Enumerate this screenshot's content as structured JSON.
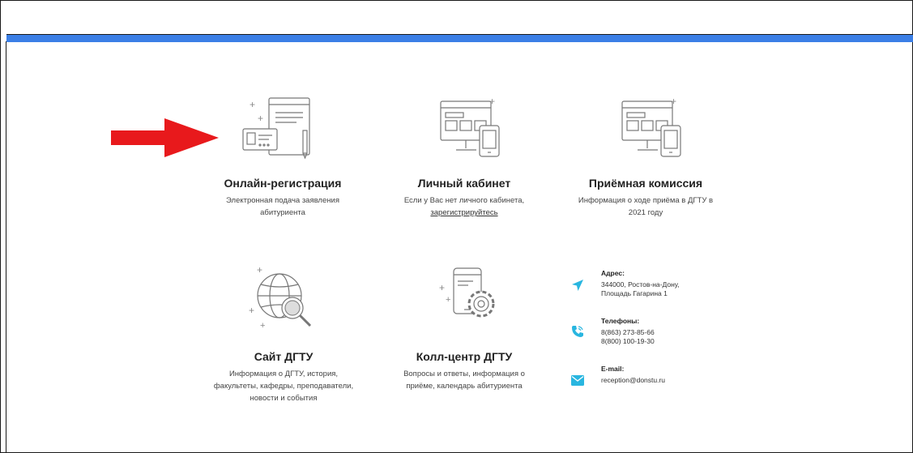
{
  "cards": [
    {
      "title": "Онлайн-регистрация",
      "desc1": "Электронная подача заявления",
      "desc2": "абитуриента"
    },
    {
      "title": "Личный кабинет",
      "desc1": "Если у Вас нет личного кабинета,",
      "link": "зарегистрируйтесь"
    },
    {
      "title": "Приёмная комиссия",
      "desc1": "Информация о ходе приёма в ДГТУ в",
      "desc2": "2021 году"
    },
    {
      "title": "Сайт ДГТУ",
      "desc1": "Информация о ДГТУ, история,",
      "desc2": "факультеты, кафедры, преподаватели,",
      "desc3": "новости и события"
    },
    {
      "title": "Колл-центр ДГТУ",
      "desc1": "Вопросы и ответы, информация о",
      "desc2": "приёме, календарь абитуриента"
    }
  ],
  "contacts": {
    "address": {
      "label": "Адрес:",
      "line1": "344000, Ростов-на-Дону,",
      "line2": "Площадь Гагарина 1"
    },
    "phones": {
      "label": "Телефоны:",
      "line1": "8(863) 273-85-66",
      "line2": "8(800) 100-19-30"
    },
    "email": {
      "label": "E-mail:",
      "line1": "reception@donstu.ru"
    }
  },
  "colors": {
    "accent_bar": "#3b7fe6",
    "arrow": "#e8191c",
    "contact_icons": "#29b6e0"
  },
  "icons": {
    "card1": "registration-form-icon",
    "card2": "devices-icon",
    "card3": "devices-icon",
    "card4": "globe-search-icon",
    "card5": "phone-settings-icon",
    "address": "location-arrow-icon",
    "phones": "phone-call-icon",
    "email": "envelope-icon"
  }
}
